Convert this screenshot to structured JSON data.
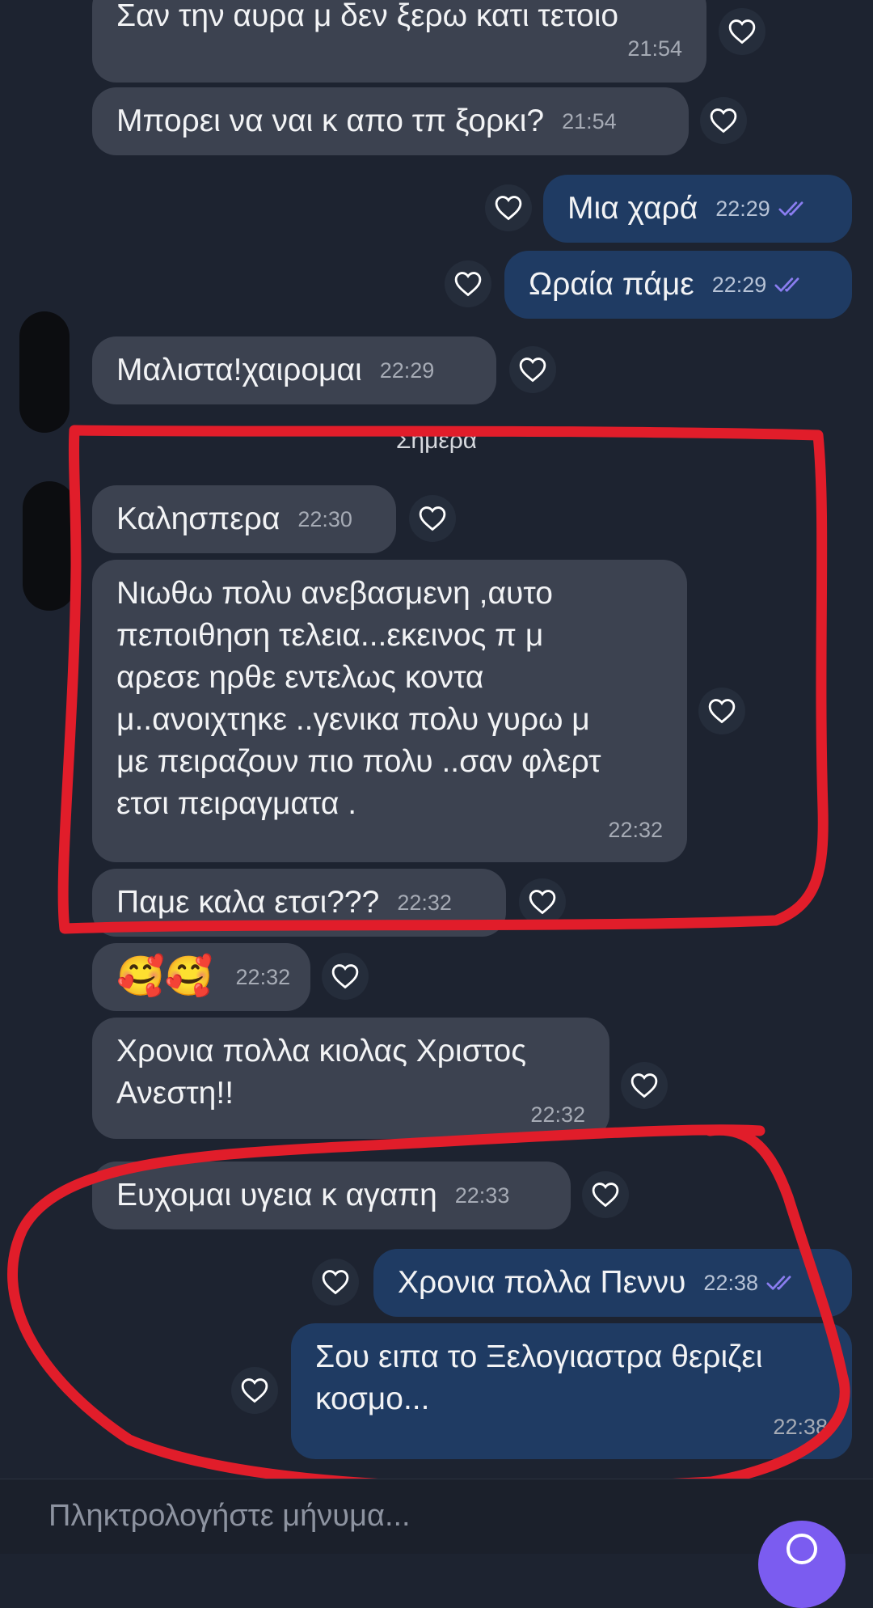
{
  "messages": [
    {
      "text": "Σαν την αυρα μ δεν ξερω κατι τετοιο",
      "time": "21:54"
    },
    {
      "text": "Μπορει να ναι κ απο τπ ξορκι?",
      "time": "21:54"
    },
    {
      "text": "Μια χαρά",
      "time": "22:29"
    },
    {
      "text": "Ωραία πάμε",
      "time": "22:29"
    },
    {
      "text": "Μαλιστα!χαιρομαι",
      "time": "22:29"
    },
    {
      "text": "Καλησπερα",
      "time": "22:30"
    },
    {
      "lines": [
        "Νιωθω πολυ ανεβασμενη ,αυτο",
        "πεποιθηση τελεια...εκεινος π μ",
        "αρεσε ηρθε εντελως κοντα",
        "μ..ανοιχτηκε ..γενικα πολυ γυρω μ",
        "με πειραζουν πιο πολυ ..σαν φλερτ",
        "ετσι πειραγματα  ."
      ],
      "time": "22:32"
    },
    {
      "text": "Παμε καλα ετσι???",
      "time": "22:32"
    },
    {
      "text": "🥰🥰",
      "time": "22:32"
    },
    {
      "lines": [
        "Χρονια πολλα κιολας Χριστος",
        "Ανεστη!!"
      ],
      "time": "22:32"
    },
    {
      "text": "Ευχομαι υγεια κ αγαπη",
      "time": "22:33"
    },
    {
      "text": "Χρονια πολλα Πεννυ",
      "time": "22:38"
    },
    {
      "lines": [
        "Σου ειπα το Ξελογιαστρα θεριζει",
        "κοσμο..."
      ],
      "time": "22:38"
    }
  ],
  "date_separator": "Σημερα",
  "composer": {
    "placeholder": "Πληκτρολογήστε μήνυμα..."
  },
  "icons": {
    "reaction": "heart-outline-icon",
    "read": "double-check-icon",
    "action": "camera-icon"
  },
  "colors": {
    "background": "#1d2330",
    "incoming": "#3c4250",
    "outgoing": "#1f3b63",
    "annotation": "#e11d2a",
    "accent": "#7b5cf0"
  }
}
